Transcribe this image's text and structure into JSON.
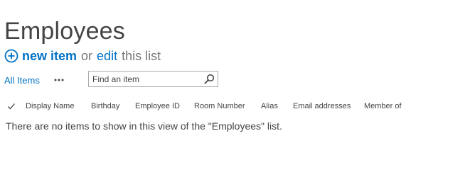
{
  "page": {
    "title": "Employees"
  },
  "actions": {
    "new_item": "new item",
    "or": "or",
    "edit": "edit",
    "this_list": "this list"
  },
  "view": {
    "all_items": "All Items",
    "more_label": "•••"
  },
  "search": {
    "placeholder": "Find an item"
  },
  "columns": [
    "Display Name",
    "Birthday",
    "Employee ID",
    "Room Number",
    "Alias",
    "Email addresses",
    "Member of"
  ],
  "empty_message": "There are no items to show in this view of the \"Employees\" list.",
  "icons": {
    "new": "plus-circle-icon",
    "search": "search-icon",
    "select_all": "checkmark-icon",
    "more": "ellipsis-icon"
  },
  "colors": {
    "link": "#0072c6",
    "text": "#444444",
    "muted": "#777777"
  }
}
